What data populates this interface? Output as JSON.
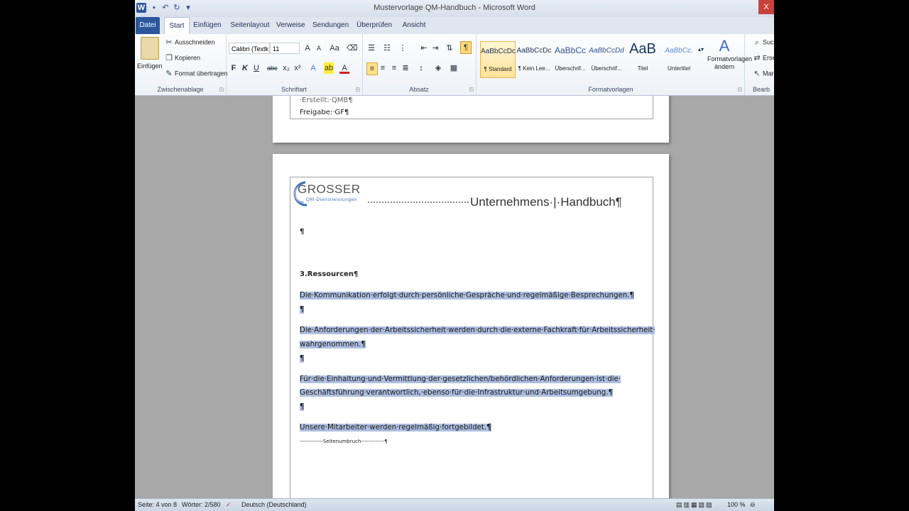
{
  "window": {
    "title": "Mustervorlage QM-Handbuch - Microsoft Word",
    "close_glyph": "X"
  },
  "quick_access": {
    "app_icon": "W"
  },
  "tabs": [
    "Datei",
    "Start",
    "Einfügen",
    "Seitenlayout",
    "Verweise",
    "Sendungen",
    "Überprüfen",
    "Ansicht"
  ],
  "ribbon": {
    "clipboard": {
      "paste": "Einfügen",
      "cut": "Ausschneiden",
      "copy": "Kopieren",
      "format_painter": "Format übertragen",
      "label": "Zwischenablage"
    },
    "font": {
      "name": "Calibri (Textk",
      "size": "11",
      "label": "Schriftart"
    },
    "paragraph": {
      "label": "Absatz"
    },
    "styles": {
      "items": [
        {
          "preview": "AaBbCcDc",
          "name": "¶ Standard"
        },
        {
          "preview": "AaBbCcDc",
          "name": "¶ Kein Lee..."
        },
        {
          "preview": "AaBbCc",
          "name": "Überschrif..."
        },
        {
          "preview": "AaBbCcDd",
          "name": "Überschrif..."
        },
        {
          "preview": "AaB",
          "name": "Titel"
        },
        {
          "preview": "AaBbCc.",
          "name": "Untertitel"
        }
      ],
      "change_styles": "Formatvorlagen ändern",
      "label": "Formatvorlagen"
    },
    "editing": {
      "find": "Such",
      "replace": "Erset",
      "select": "Mark",
      "label": "Bearb"
    }
  },
  "document": {
    "page1_lines": [
      "·Erstellt:·QMB¶",
      "Freigabe:·GF¶"
    ],
    "logo_text": "GROSSER",
    "logo_sub": "QM-Dienstleistungen",
    "header_title": "Unternehmens·|·Handbuch¶",
    "pilcrow": "¶",
    "heading": "3.Ressourcen¶",
    "paragraphs": [
      [
        "Die·Kommunikation·erfolgt·durch·persönliche·Gespräche·und·regelmäßige·Besprechungen.¶"
      ],
      [
        "¶"
      ],
      [
        "Die·Anforderungen·der·Arbeitssicherheit·werden·durch·die·externe·Fachkraft·für·Arbeitssicherheit·",
        "wahrgenommen.¶"
      ],
      [
        "¶"
      ],
      [
        "Für·die·Einhaltung·und·Vermittlung·der·gesetzlichen/behördlichen·Anforderungen·ist·die·",
        "Geschäftsführung·verantwortlich,·ebenso·für·die·Infrastruktur·und·Arbeitsumgebung.¶"
      ],
      [
        "¶"
      ],
      [
        "Unsere·Mitarbeiter·werden·regelmäßig·fortgebildet.¶"
      ]
    ],
    "page_break": "-------------Seitenumbruch-------------¶"
  },
  "status": {
    "page": "Seite: 4 von 8",
    "words": "Wörter: 2/580",
    "language": "Deutsch (Deutschland)",
    "zoom": "100 %"
  },
  "colors": {
    "file_tab": "#2b579a",
    "selection": "#aebfe0",
    "logo_blue": "#3c6fb5"
  }
}
